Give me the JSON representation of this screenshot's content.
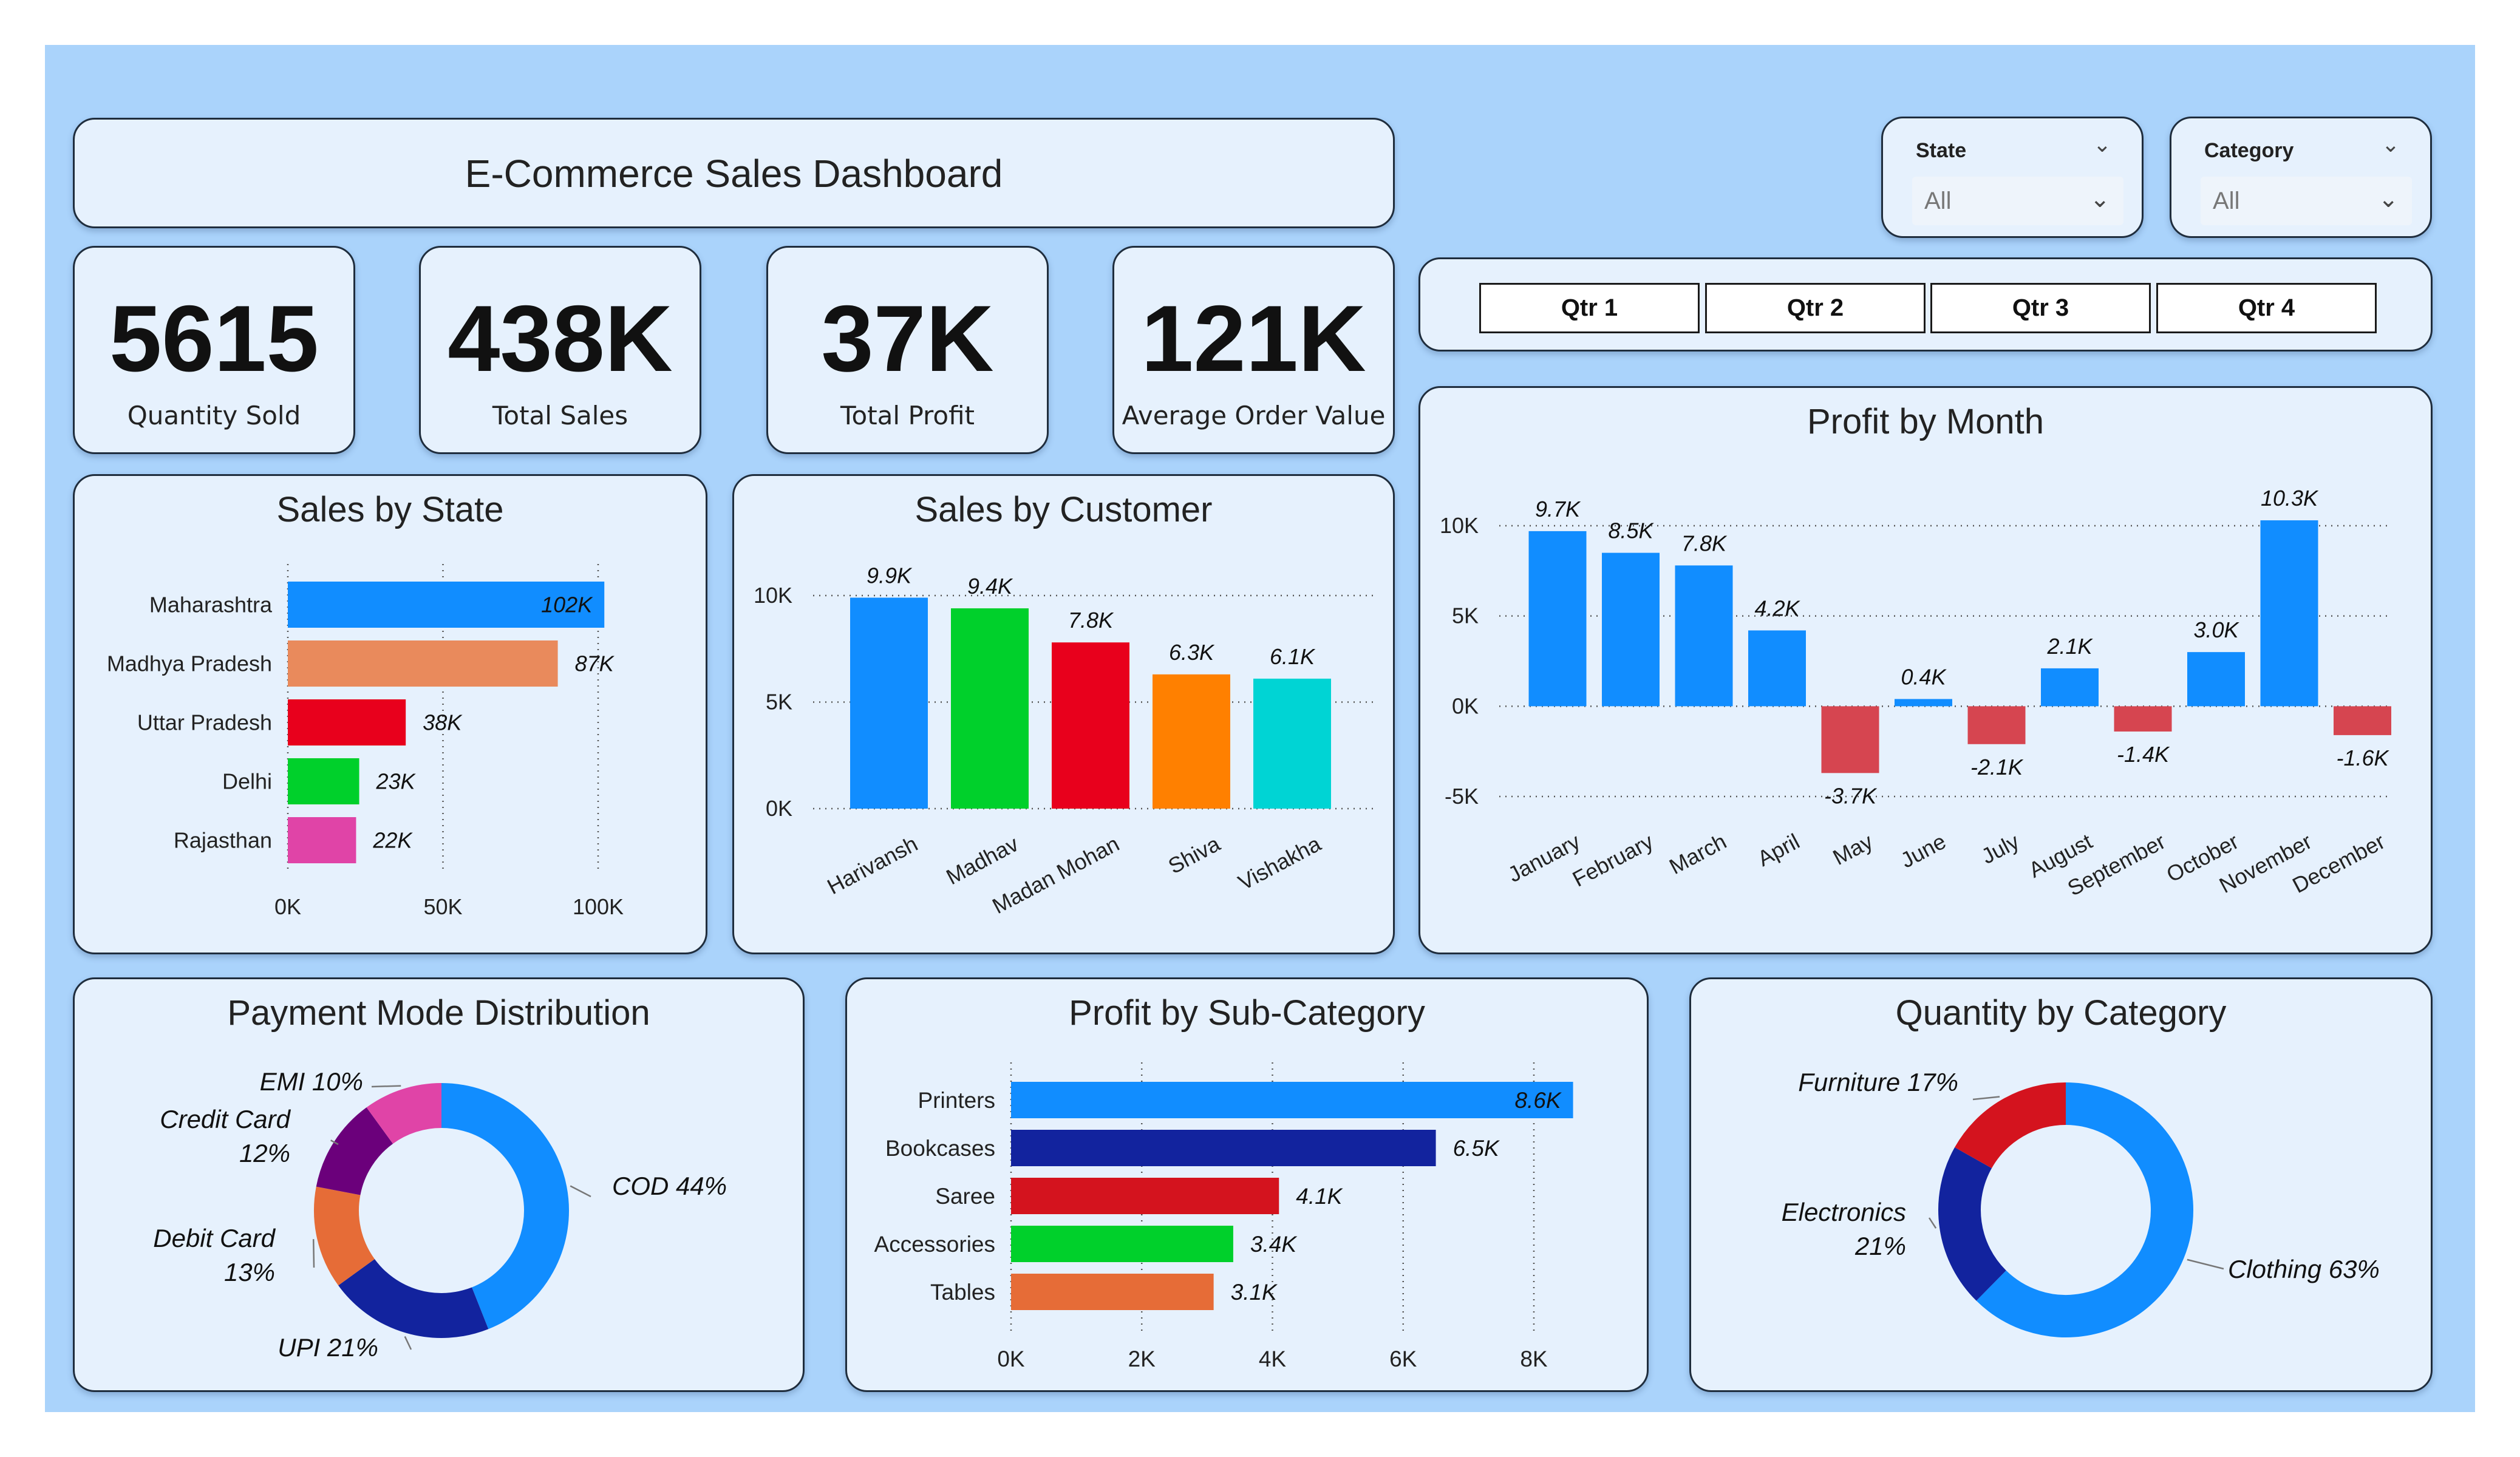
{
  "dashboard": {
    "title": "E-Commerce Sales Dashboard"
  },
  "kpis": [
    {
      "value": "5615",
      "label": "Quantity Sold"
    },
    {
      "value": "438K",
      "label": "Total Sales"
    },
    {
      "value": "37K",
      "label": "Total Profit"
    },
    {
      "value": "121K",
      "label": "Average Order Value"
    }
  ],
  "filters": {
    "state": {
      "label": "State",
      "value": "All"
    },
    "category": {
      "label": "Category",
      "value": "All"
    }
  },
  "quarters": [
    "Qtr 1",
    "Qtr 2",
    "Qtr 3",
    "Qtr 4"
  ],
  "colors": {
    "background": "#aad3fb",
    "card": "#e6f1fd",
    "positive": "#118dff",
    "negative": "#d64550"
  },
  "chart_data": [
    {
      "id": "sales_by_state",
      "type": "bar",
      "orientation": "horizontal",
      "title": "Sales by State",
      "categories": [
        "Maharashtra",
        "Madhya Pradesh",
        "Uttar Pradesh",
        "Delhi",
        "Rajasthan"
      ],
      "values": [
        102000,
        87000,
        38000,
        23000,
        22000
      ],
      "labels": [
        "102K",
        "87K",
        "38K",
        "23K",
        "22K"
      ],
      "colors": [
        "#118dff",
        "#e98a5c",
        "#e8001c",
        "#00d02b",
        "#e044a7"
      ],
      "xlim": [
        0,
        100000
      ],
      "ticks": [
        0,
        50000,
        100000
      ],
      "tick_labels": [
        "0K",
        "50K",
        "100K"
      ],
      "grid": true
    },
    {
      "id": "sales_by_customer",
      "type": "bar",
      "orientation": "vertical",
      "title": "Sales by Customer",
      "categories": [
        "Harivansh",
        "Madhav",
        "Madan Mohan",
        "Shiva",
        "Vishakha"
      ],
      "values": [
        9900,
        9400,
        7800,
        6300,
        6100
      ],
      "labels": [
        "9.9K",
        "9.4K",
        "7.8K",
        "6.3K",
        "6.1K"
      ],
      "colors": [
        "#118dff",
        "#00d02b",
        "#e8001c",
        "#ff8000",
        "#00d4d4"
      ],
      "ylim": [
        0,
        10000
      ],
      "ticks": [
        0,
        5000,
        10000
      ],
      "tick_labels": [
        "0K",
        "5K",
        "10K"
      ],
      "grid": true
    },
    {
      "id": "profit_by_month",
      "type": "bar",
      "orientation": "vertical",
      "title": "Profit by Month",
      "categories": [
        "January",
        "February",
        "March",
        "April",
        "May",
        "June",
        "July",
        "August",
        "September",
        "October",
        "November",
        "December"
      ],
      "values": [
        9700,
        8500,
        7800,
        4200,
        -3700,
        400,
        -2100,
        2100,
        -1400,
        3000,
        10300,
        -1600
      ],
      "labels": [
        "9.7K",
        "8.5K",
        "7.8K",
        "4.2K",
        "-3.7K",
        "0.4K",
        "-2.1K",
        "2.1K",
        "-1.4K",
        "3.0K",
        "10.3K",
        "-1.6K"
      ],
      "ylim": [
        -5000,
        10000
      ],
      "ticks": [
        -5000,
        0,
        5000,
        10000
      ],
      "tick_labels": [
        "-5K",
        "0K",
        "5K",
        "10K"
      ],
      "grid": true
    },
    {
      "id": "payment_mode",
      "type": "pie",
      "subtype": "donut",
      "title": "Payment Mode Distribution",
      "categories": [
        "COD",
        "UPI",
        "Debit Card",
        "Credit Card",
        "EMI"
      ],
      "values": [
        44,
        21,
        13,
        12,
        10
      ],
      "labels": [
        "COD 44%",
        "UPI 21%",
        "Debit Card 13%",
        "Credit Card 12%",
        "EMI 10%"
      ],
      "colors": [
        "#118dff",
        "#12239e",
        "#e66c37",
        "#6b007b",
        "#e044a7"
      ]
    },
    {
      "id": "profit_by_subcategory",
      "type": "bar",
      "orientation": "horizontal",
      "title": "Profit by Sub-Category",
      "categories": [
        "Printers",
        "Bookcases",
        "Saree",
        "Accessories",
        "Tables"
      ],
      "values": [
        8600,
        6500,
        4100,
        3400,
        3100
      ],
      "labels": [
        "8.6K",
        "6.5K",
        "4.1K",
        "3.4K",
        "3.1K"
      ],
      "colors": [
        "#118dff",
        "#12239e",
        "#d4131e",
        "#00d02b",
        "#e66c37"
      ],
      "xlim": [
        0,
        8000
      ],
      "ticks": [
        0,
        2000,
        4000,
        6000,
        8000
      ],
      "tick_labels": [
        "0K",
        "2K",
        "4K",
        "6K",
        "8K"
      ],
      "grid": true
    },
    {
      "id": "quantity_by_category",
      "type": "pie",
      "subtype": "donut",
      "title": "Quantity by Category",
      "categories": [
        "Clothing",
        "Electronics",
        "Furniture"
      ],
      "values": [
        63,
        21,
        17
      ],
      "labels": [
        "Clothing 63%",
        "Electronics 21%",
        "Furniture 17%"
      ],
      "colors": [
        "#118dff",
        "#12239e",
        "#d4131e"
      ]
    }
  ]
}
